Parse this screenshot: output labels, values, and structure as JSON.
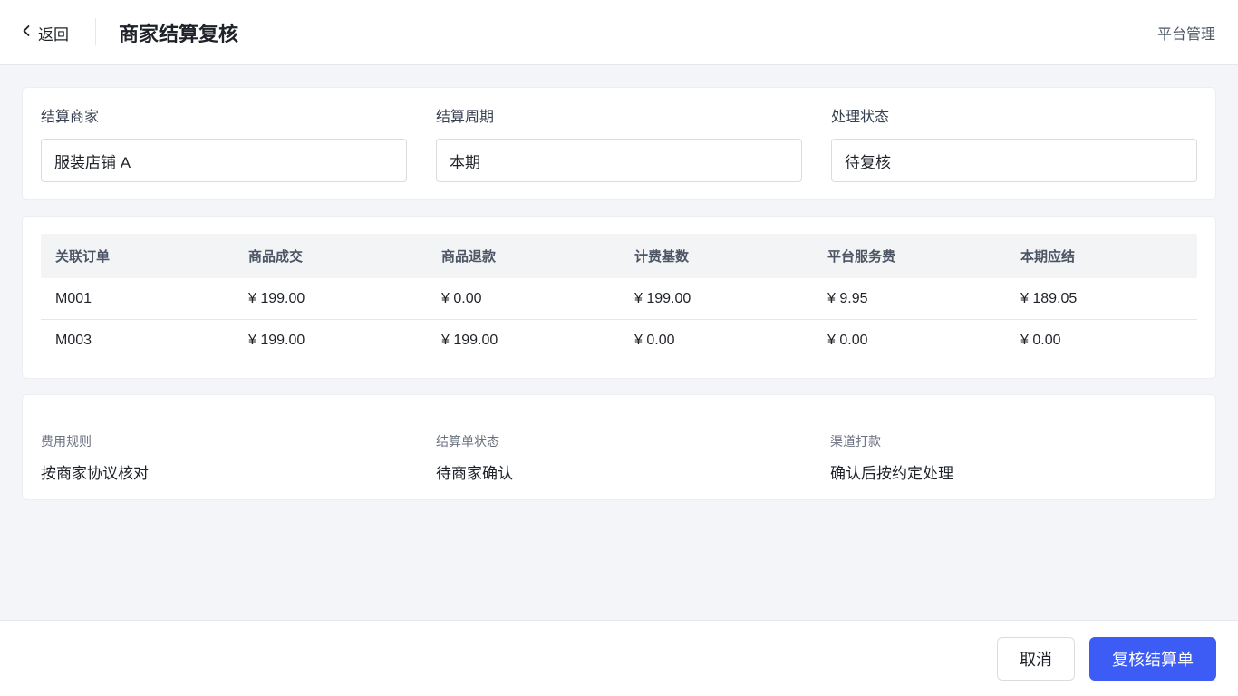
{
  "header": {
    "back_label": "返回",
    "title": "商家结算复核",
    "platform_label": "平台管理"
  },
  "filters": [
    {
      "label": "结算商家",
      "value": "服装店铺 A"
    },
    {
      "label": "结算周期",
      "value": "本期"
    },
    {
      "label": "处理状态",
      "value": "待复核"
    }
  ],
  "table": {
    "columns": [
      "关联订单",
      "商品成交",
      "商品退款",
      "计费基数",
      "平台服务费",
      "本期应结"
    ],
    "rows": [
      [
        "M001",
        "¥ 199.00",
        "¥ 0.00",
        "¥ 199.00",
        "¥ 9.95",
        "¥ 189.05"
      ],
      [
        "M003",
        "¥ 199.00",
        "¥ 199.00",
        "¥ 0.00",
        "¥ 0.00",
        "¥ 0.00"
      ]
    ]
  },
  "info": [
    {
      "label": "费用规则",
      "value": "按商家协议核对"
    },
    {
      "label": "结算单状态",
      "value": "待商家确认"
    },
    {
      "label": "渠道打款",
      "value": "确认后按约定处理"
    }
  ],
  "footer": {
    "cancel_label": "取消",
    "submit_label": "复核结算单"
  },
  "colors": {
    "primary": "#3d5cf5",
    "background": "#f4f5f8"
  },
  "icons": {
    "back": "chevron-left-icon"
  }
}
